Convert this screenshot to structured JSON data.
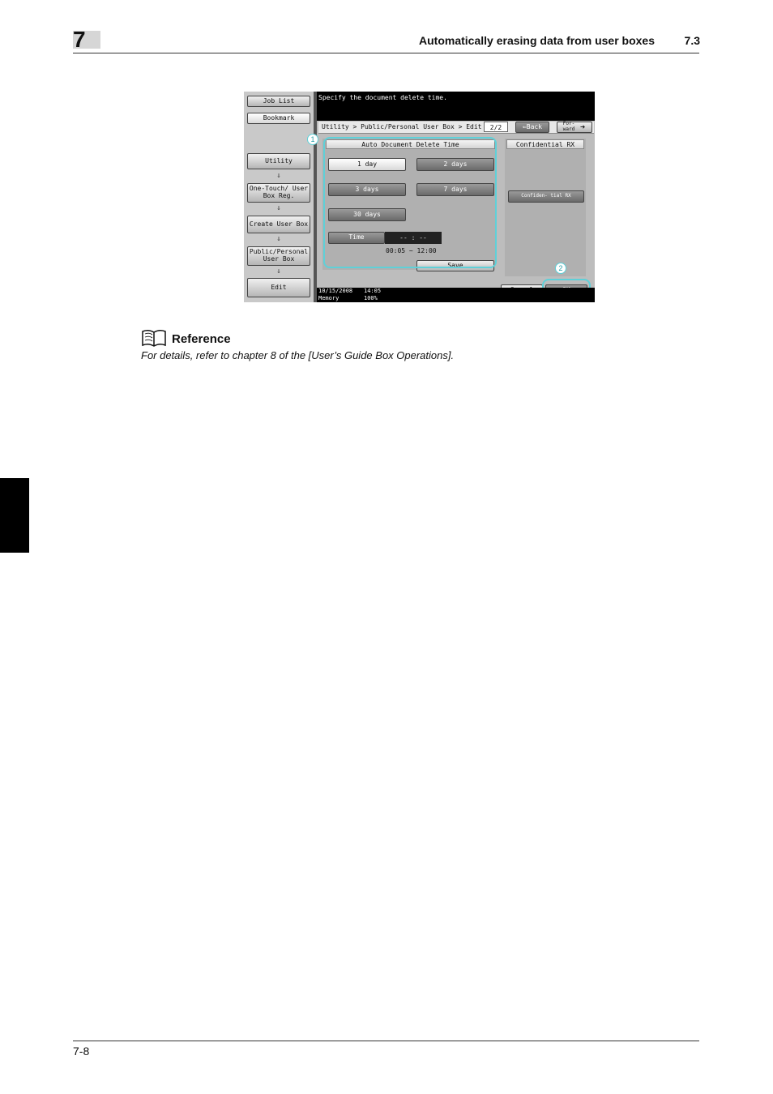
{
  "header": {
    "chapter": "7",
    "title": "Automatically erasing data from user boxes",
    "section": "7.3"
  },
  "screen": {
    "message": "Specify the document delete time.",
    "left_nav": {
      "job_list": "Job List",
      "bookmark": "Bookmark",
      "utility": "Utility",
      "one_touch": "One-Touch/ User Box Reg.",
      "create_user_box": "Create User Box",
      "public_personal": "Public/Personal User Box",
      "edit": "Edit",
      "arrow": "⇓"
    },
    "breadcrumb": "Utility > Public/Personal User  Box > Edit",
    "page_indicator": "2/2",
    "back_label": "⇐Back",
    "forward_label": "For- ward",
    "auto_delete": {
      "heading": "Auto Document Delete Time",
      "options": [
        "1 day",
        "2 days",
        "3 days",
        "7 days",
        "30 days"
      ],
      "time_label": "Time",
      "time_value": "-- : --",
      "range_text": "00:05  ~  12:00",
      "save_label": "Save"
    },
    "confidential": {
      "heading": "Confidential RX",
      "button": "Confiden- tial RX"
    },
    "cancel_label": "Cancel",
    "ok_label": "OK",
    "status_date": "10/15/2008",
    "status_time": "14:05",
    "status_memory": "Memory",
    "status_pct": "100%",
    "callouts": [
      "1",
      "2"
    ]
  },
  "reference": {
    "title": "Reference",
    "body": "For details, refer to chapter 8 of the [User’s Guide Box Operations]."
  },
  "footer": {
    "page_number": "7-8"
  }
}
